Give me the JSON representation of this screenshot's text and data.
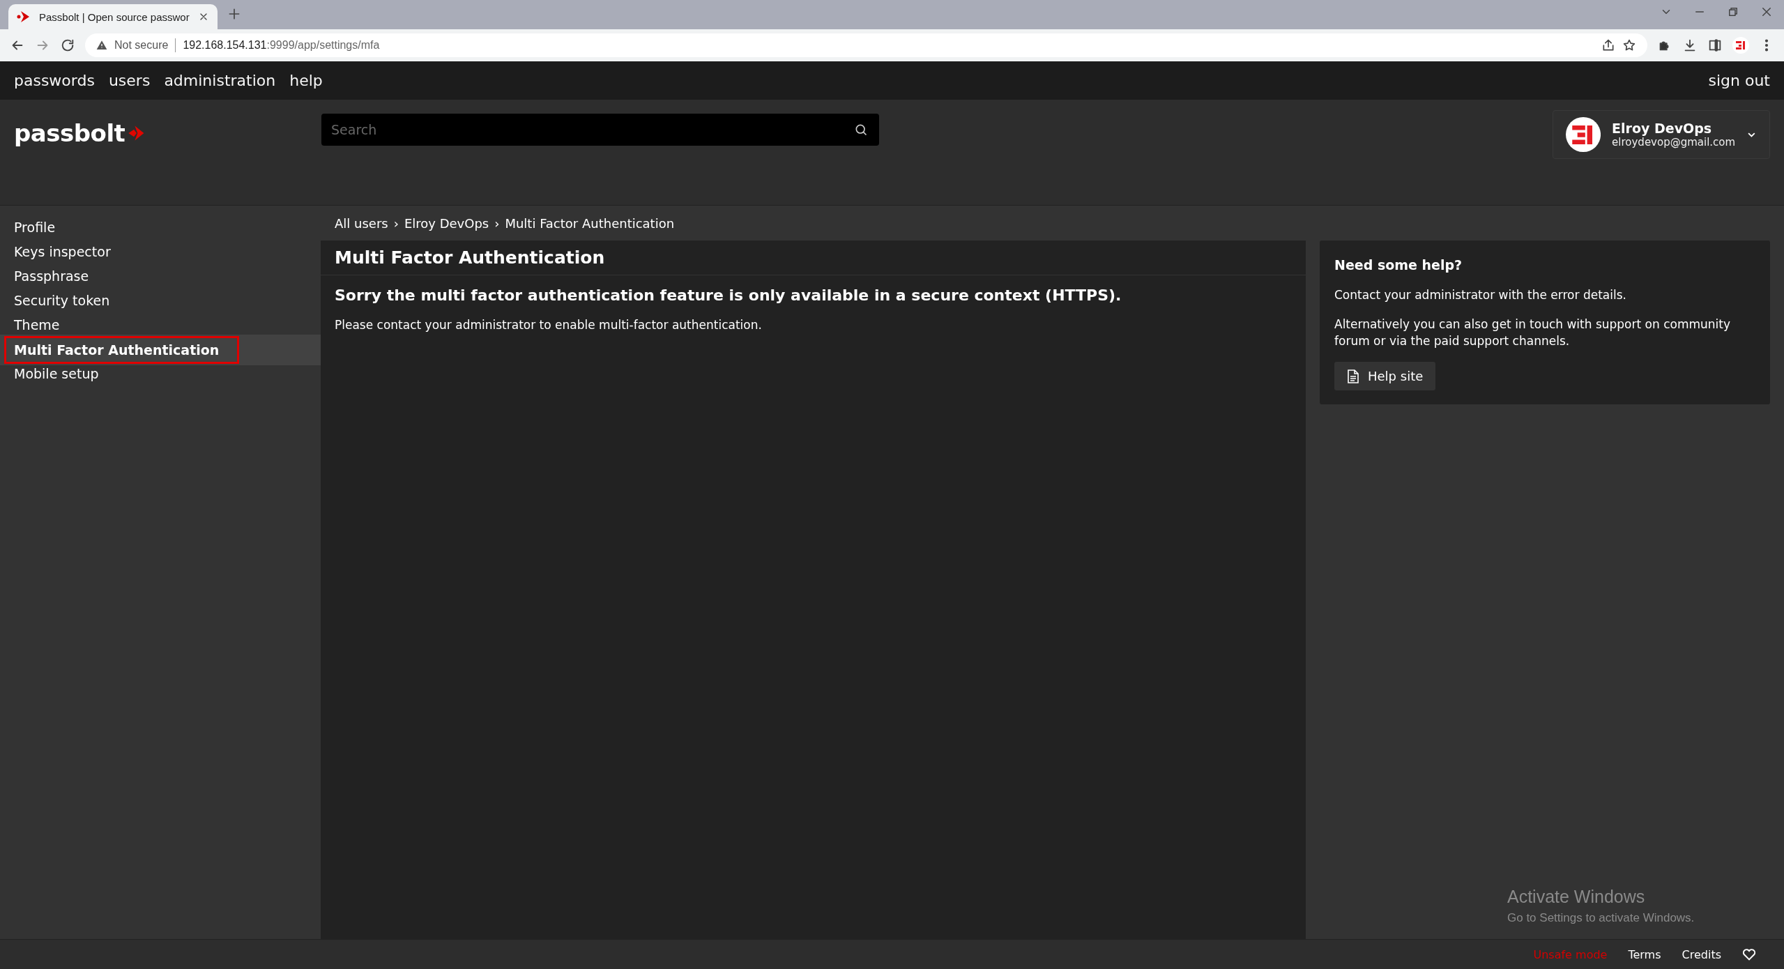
{
  "browser": {
    "tab_title": "Passbolt | Open source passwor",
    "security_label": "Not secure",
    "url_host": "192.168.154.131",
    "url_rest": ":9999/app/settings/mfa"
  },
  "top_nav": {
    "items": [
      "passwords",
      "users",
      "administration",
      "help"
    ],
    "sign_out": "sign out"
  },
  "header": {
    "logo": "passbolt",
    "search": {
      "placeholder": "Search"
    },
    "user": {
      "name": "Elroy DevOps",
      "email": "elroydevop@gmail.com"
    }
  },
  "sidebar": {
    "items": [
      {
        "label": "Profile",
        "selected": false,
        "annotated": false
      },
      {
        "label": "Keys inspector",
        "selected": false,
        "annotated": false
      },
      {
        "label": "Passphrase",
        "selected": false,
        "annotated": false
      },
      {
        "label": "Security token",
        "selected": false,
        "annotated": false
      },
      {
        "label": "Theme",
        "selected": false,
        "annotated": false
      },
      {
        "label": "Multi Factor Authentication",
        "selected": true,
        "annotated": true
      },
      {
        "label": "Mobile setup",
        "selected": false,
        "annotated": false
      }
    ]
  },
  "breadcrumb": {
    "separator": "›",
    "items": [
      "All users",
      "Elroy DevOps",
      "Multi Factor Authentication"
    ]
  },
  "main": {
    "title": "Multi Factor Authentication",
    "heading": "Sorry the multi factor authentication feature is only available in a secure context (HTTPS).",
    "message": "Please contact your administrator to enable multi-factor authentication."
  },
  "help": {
    "title": "Need some help?",
    "paragraphs": [
      "Contact your administrator with the error details.",
      "Alternatively you can also get in touch with support on community forum or via the paid support channels."
    ],
    "button": "Help site"
  },
  "os_overlay": {
    "title": "Activate Windows",
    "subtitle": "Go to Settings to activate Windows."
  },
  "footer": {
    "links": [
      {
        "label": "Unsafe mode",
        "kind": "warning"
      },
      {
        "label": "Terms",
        "kind": "link"
      },
      {
        "label": "Credits",
        "kind": "link"
      }
    ]
  }
}
